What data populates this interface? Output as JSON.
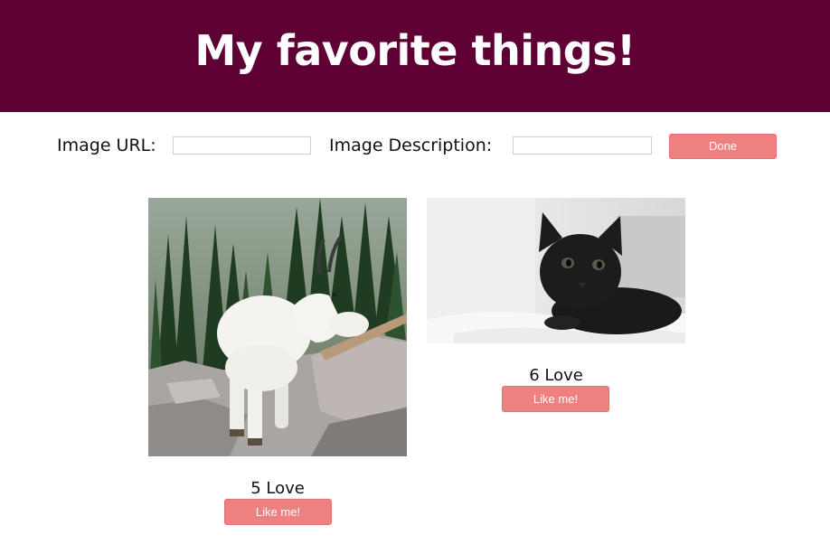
{
  "header": {
    "title": "My favorite things!",
    "background_color": "#5e0034"
  },
  "form": {
    "url_label": "Image URL:",
    "url_value": "",
    "description_label": "Image Description:",
    "description_value": "",
    "done_label": "Done"
  },
  "cards": [
    {
      "image_subject": "mountain goat on rocks with pine trees",
      "love_count": "5 Love",
      "like_label": "Like me!"
    },
    {
      "image_subject": "black cat lying on white bedding",
      "love_count": "6 Love",
      "like_label": "Like me!"
    }
  ],
  "colors": {
    "accent": "#ef8080",
    "text": "#111111"
  }
}
